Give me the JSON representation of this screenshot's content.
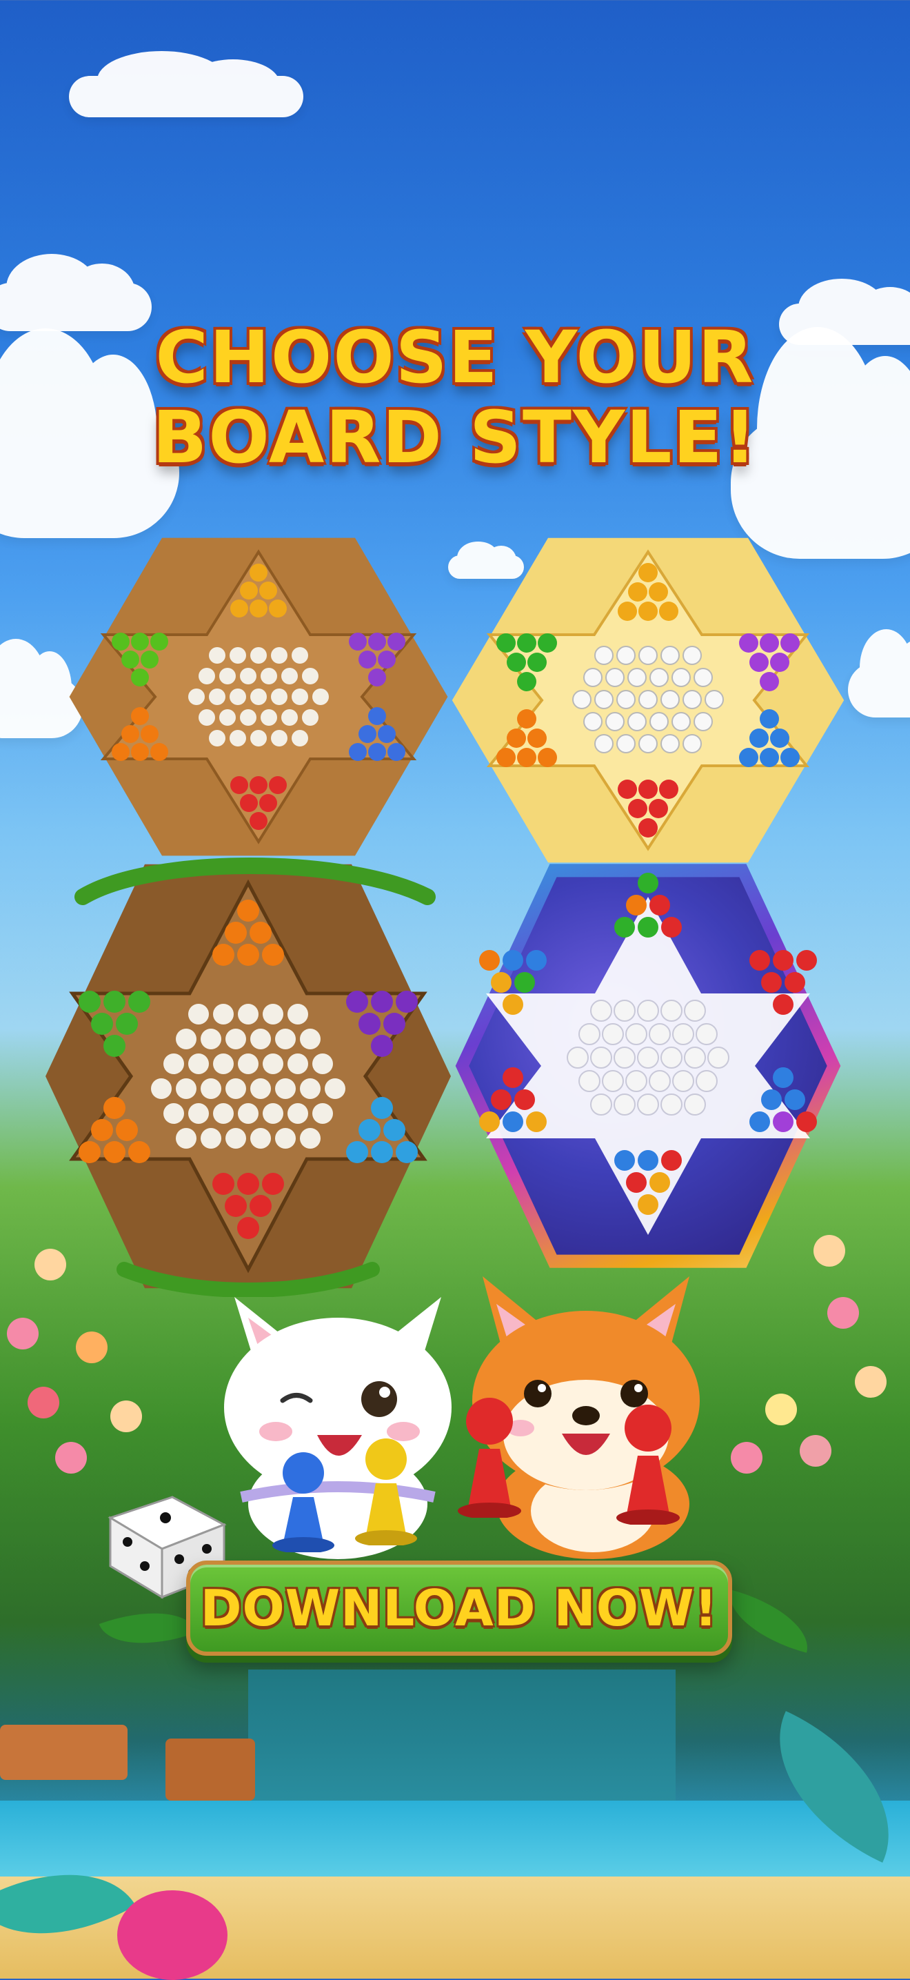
{
  "headline": {
    "line1": "CHOOSE YOUR",
    "line2": "BOARD STYLE!"
  },
  "cta": {
    "label": "DOWNLOAD NOW!"
  },
  "boards": [
    {
      "style": "classic-wood",
      "frame": "#b47a3a",
      "field": "#c48a4a",
      "hole": "#f3efe6",
      "corners": [
        "#f0a818",
        "#8f3fd0",
        "#3b6fe0",
        "#e02a2a",
        "#f07a10",
        "#56c01e"
      ]
    },
    {
      "style": "cream-glossy",
      "frame": "#f4d878",
      "field": "#fbe8a0",
      "hole": "#f8f8f8",
      "corners": [
        "#f0a818",
        "#a13fd8",
        "#2f7fe0",
        "#e02a2a",
        "#f07a10",
        "#2fb02a"
      ]
    },
    {
      "style": "jungle-vine",
      "frame": "#8a5a2a",
      "field": "#a8743e",
      "hole": "#f3efe6",
      "corners": [
        "#f07a10",
        "#7a2fc0",
        "#2fa0e0",
        "#e02a2a",
        "#f07a10",
        "#3fb02a"
      ]
    },
    {
      "style": "galaxy-rainbow",
      "frame": "#6a3fd0",
      "field": "#3f3fb8",
      "hole": "#f5f5f5",
      "corners": [
        "#2fb02a",
        "#e02a2a",
        "#2f7fe0",
        "#e02a2a",
        "#f0a818",
        "#f0a818"
      ]
    }
  ],
  "colors": {
    "title_fill": "#ffd21f",
    "title_outline": "#b43a12",
    "cta_green": "#4fae2a"
  },
  "icons": [
    "dice-icon",
    "cat-mascot",
    "dog-mascot",
    "pawn-blue-icon",
    "pawn-yellow-icon",
    "pawn-red-icon"
  ]
}
